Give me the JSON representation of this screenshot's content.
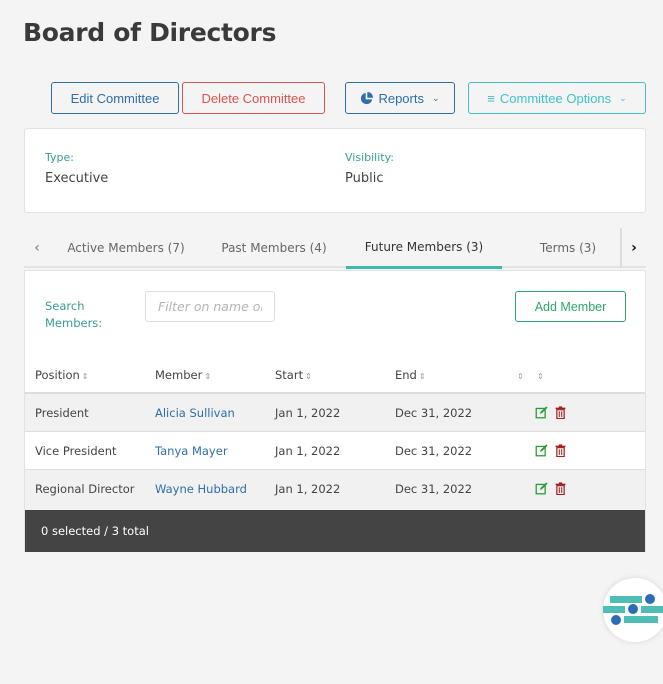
{
  "header": {
    "title": "Board of Directors"
  },
  "toolbar": {
    "edit_label": "Edit Committee",
    "delete_label": "Delete Committee",
    "reports_label": "Reports",
    "options_label": "Committee Options"
  },
  "info": {
    "type_label": "Type:",
    "type_value": "Executive",
    "visibility_label": "Visibility:",
    "visibility_value": "Public"
  },
  "tabs": [
    {
      "label": "Active Members (7)"
    },
    {
      "label": "Past Members (4)"
    },
    {
      "label": "Future Members (3)",
      "active": true
    },
    {
      "label": "Terms (3)"
    }
  ],
  "search": {
    "label": "Search Members:",
    "placeholder": "Filter on name or",
    "value": ""
  },
  "add_member_label": "Add Member",
  "table": {
    "columns": [
      "Position",
      "Member",
      "Start",
      "End"
    ],
    "rows": [
      {
        "position": "President",
        "member": "Alicia Sullivan",
        "start": "Jan 1, 2022",
        "end": "Dec 31, 2022"
      },
      {
        "position": "Vice President",
        "member": "Tanya Mayer",
        "start": "Jan 1, 2022",
        "end": "Dec 31, 2022"
      },
      {
        "position": "Regional Director",
        "member": "Wayne Hubbard",
        "start": "Jan 1, 2022",
        "end": "Dec 31, 2022"
      }
    ],
    "footer": "0 selected / 3 total"
  },
  "colors": {
    "primary": "#2f6ea8",
    "danger": "#d9534f",
    "accent": "#3fc1c9",
    "success": "#2fa56a",
    "teal_label": "#3a9b94"
  }
}
